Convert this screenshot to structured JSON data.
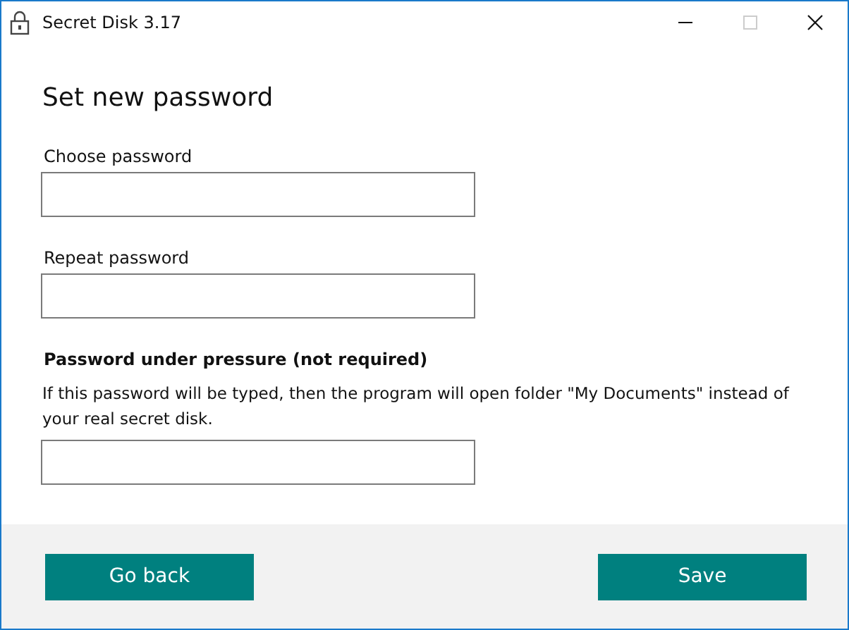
{
  "window": {
    "title": "Secret Disk 3.17",
    "maximize_disabled": true
  },
  "heading": "Set new password",
  "fields": [
    {
      "label": "Choose password",
      "bold": false
    },
    {
      "label": "Repeat password",
      "bold": false
    },
    {
      "label": "Password under pressure (not required)",
      "bold": true,
      "note": "If this password will be typed, then the program will open folder \"My Documents\" instead of your real secret disk."
    }
  ],
  "buttons": [
    "Go back",
    "Save"
  ]
}
